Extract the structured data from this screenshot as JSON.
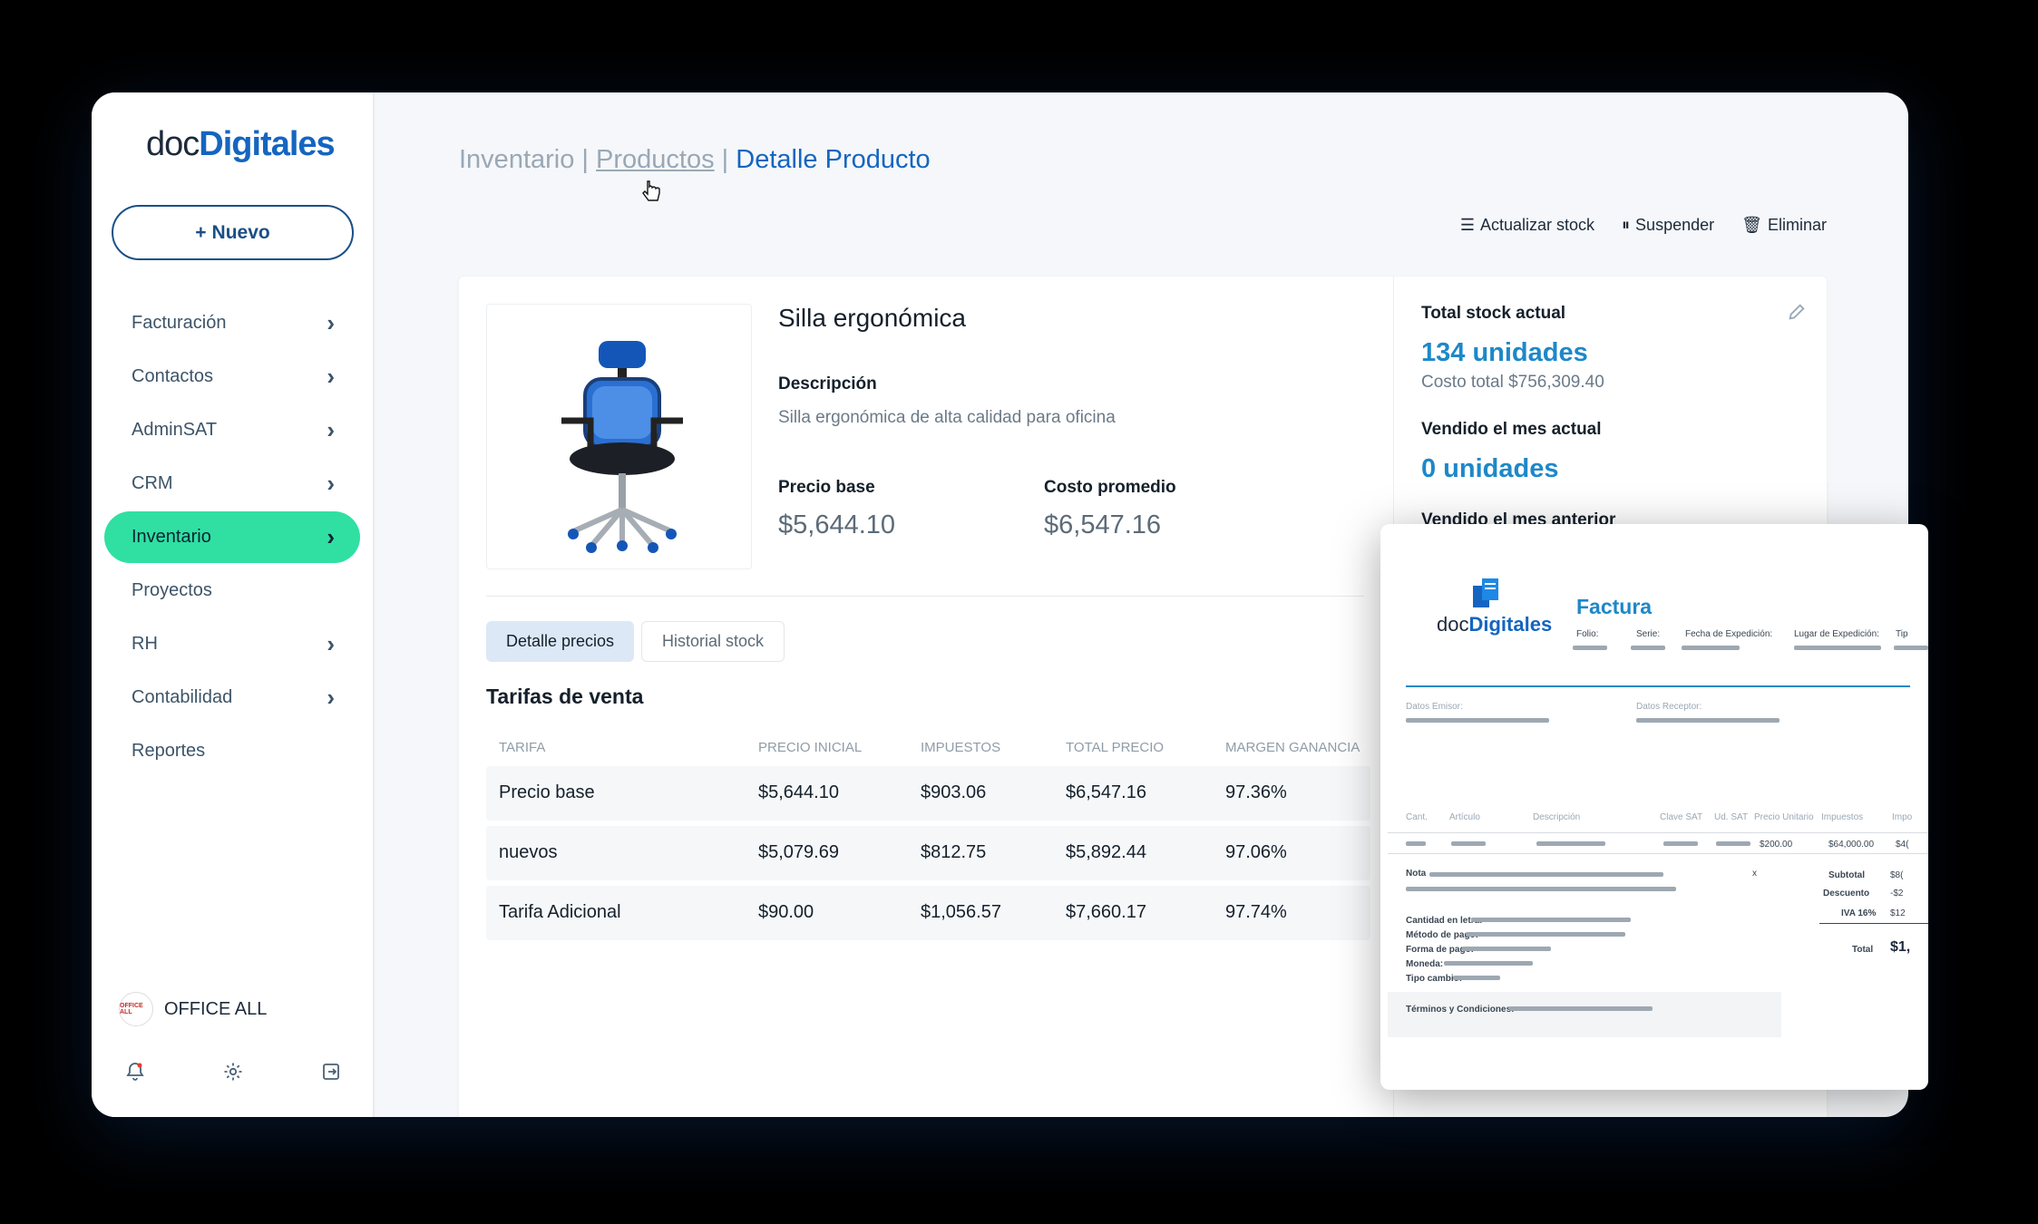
{
  "brand": {
    "logo_part1": "doc",
    "logo_part2": "Digitales"
  },
  "sidebar": {
    "new_button": "Nuevo",
    "items": [
      {
        "label": "Facturación",
        "chevron": true
      },
      {
        "label": "Contactos",
        "chevron": true
      },
      {
        "label": "AdminSAT",
        "chevron": true
      },
      {
        "label": "CRM",
        "chevron": true
      },
      {
        "label": "Inventario",
        "chevron": true,
        "active": true
      },
      {
        "label": "Proyectos",
        "chevron": false
      },
      {
        "label": "RH",
        "chevron": true
      },
      {
        "label": "Contabilidad",
        "chevron": true
      },
      {
        "label": "Reportes",
        "chevron": false
      }
    ],
    "company_name": "OFFICE ALL",
    "company_logo_text": "OFFICE ALL",
    "active_color": "#2fe0a2"
  },
  "breadcrumb": {
    "item1": "Inventario",
    "item2": "Productos",
    "current": "Detalle Producto",
    "separator": "|"
  },
  "actions": {
    "update_stock": "Actualizar stock",
    "suspend": "Suspender",
    "delete": "Eliminar"
  },
  "product": {
    "name": "Silla ergonómica",
    "description_label": "Descripción",
    "description": "Silla ergonómica de alta calidad para oficina",
    "base_price_label": "Precio base",
    "base_price": "$5,644.10",
    "avg_cost_label": "Costo promedio",
    "avg_cost": "$6,547.16"
  },
  "tabs": {
    "prices": "Detalle precios",
    "stock_history": "Historial stock"
  },
  "rates": {
    "title": "Tarifas de venta",
    "headers": [
      "TARIFA",
      "PRECIO INICIAL",
      "IMPUESTOS",
      "TOTAL PRECIO",
      "MARGEN GANANCIA"
    ],
    "rows": [
      [
        "Precio base",
        "$5,644.10",
        "$903.06",
        "$6,547.16",
        "97.36%"
      ],
      [
        "nuevos",
        "$5,079.69",
        "$812.75",
        "$5,892.44",
        "97.06%"
      ],
      [
        "Tarifa Adicional",
        "$90.00",
        "$1,056.57",
        "$7,660.17",
        "97.74%"
      ]
    ]
  },
  "stock": {
    "total_label": "Total stock actual",
    "total_value": "134 unidades",
    "total_cost": "Costo total $756,309.40",
    "sold_month_label": "Vendido el mes actual",
    "sold_month_value": "0 unidades",
    "sold_prev_label": "Vendido el mes anterior"
  },
  "invoice": {
    "logo_part1": "doc",
    "logo_part2": "Digitales",
    "title": "Factura",
    "fields": [
      "Folio:",
      "Serie:",
      "Fecha de Expedición:",
      "Lugar de Expedición:",
      "Tip"
    ],
    "issuer_label": "Datos Emisor:",
    "receiver_label": "Datos Receptor:",
    "columns": [
      "Cant.",
      "Artículo",
      "Descripción",
      "Clave SAT",
      "Ud. SAT",
      "Precio Unitario",
      "Impuestos",
      "Impo"
    ],
    "row_unit_price": "$200.00",
    "row_taxes": "$64,000.00",
    "row_amount": "$4(",
    "note_label": "Nota",
    "note_mark": "x",
    "subtotal_label": "Subtotal",
    "subtotal_value": "$8(",
    "discount_label": "Descuento",
    "discount_value": "-$2",
    "iva_label": "IVA 16%",
    "iva_value": "$12",
    "total_label": "Total",
    "total_value": "$1,",
    "meta": [
      "Cantidad en letra:",
      "Método de pago:",
      "Forma de pago:",
      "Moneda:",
      "Tipo cambio:"
    ],
    "terms_label": "Términos y Condiciones:"
  }
}
